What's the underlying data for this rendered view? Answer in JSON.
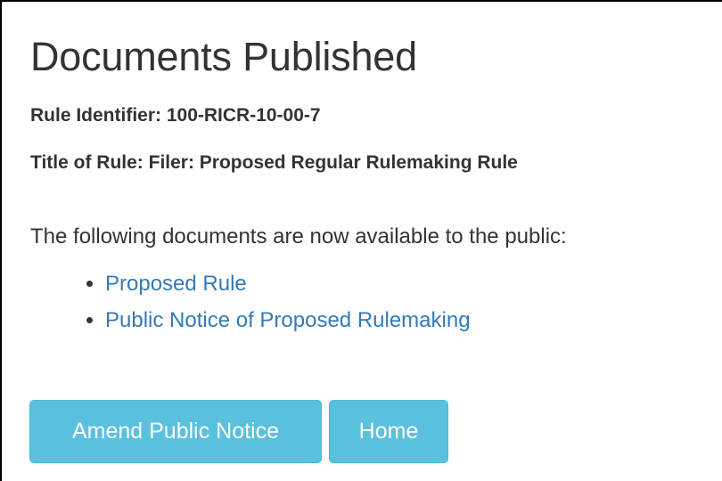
{
  "page": {
    "heading": "Documents Published",
    "rule_identifier": "Rule Identifier: 100-RICR-10-00-7",
    "rule_title": "Title of Rule: Filer: Proposed Regular Rulemaking Rule",
    "intro": "The following documents are now available to the public:"
  },
  "documents": [
    {
      "label": "Proposed Rule"
    },
    {
      "label": "Public Notice of Proposed Rulemaking"
    }
  ],
  "actions": {
    "amend_label": "Amend Public Notice",
    "home_label": "Home"
  },
  "colors": {
    "link": "#337ab7",
    "button_bg": "#5bc0de",
    "button_text": "#ffffff",
    "text": "#333333"
  }
}
